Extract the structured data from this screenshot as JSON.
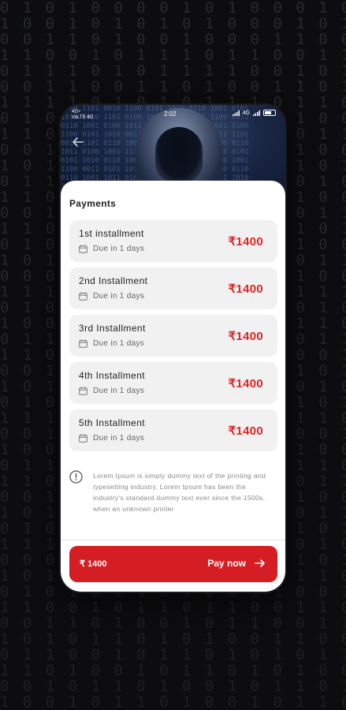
{
  "status_bar": {
    "left_top": "4G+",
    "left_bottom": "VoLTE 4G",
    "time": "2:02",
    "right": "4G"
  },
  "section_title": "Payments",
  "installments": [
    {
      "title": "1st installment",
      "due": "Due in 1 days",
      "amount": "₹1400"
    },
    {
      "title": "2nd Installment",
      "due": "Due in 1 days",
      "amount": "₹1400"
    },
    {
      "title": "3rd Installment",
      "due": "Due in 1 days",
      "amount": "₹1400"
    },
    {
      "title": "4th Installment",
      "due": "Due in 1 days",
      "amount": "₹1400"
    },
    {
      "title": "5th Installment",
      "due": "Due in 1 days",
      "amount": "₹1400"
    }
  ],
  "info_text": "Lorem Ipsum is simply dummy text of the printing and typesetting industry. Lorem Ipsum has been the industry's standard dummy text ever since the 1500s, when an unknown printer",
  "pay_bar": {
    "total": "₹ 1400",
    "cta_label": "Pay now"
  },
  "colors": {
    "accent": "#d51e24",
    "amount": "#e02424",
    "card_bg": "#f1f1f2"
  }
}
